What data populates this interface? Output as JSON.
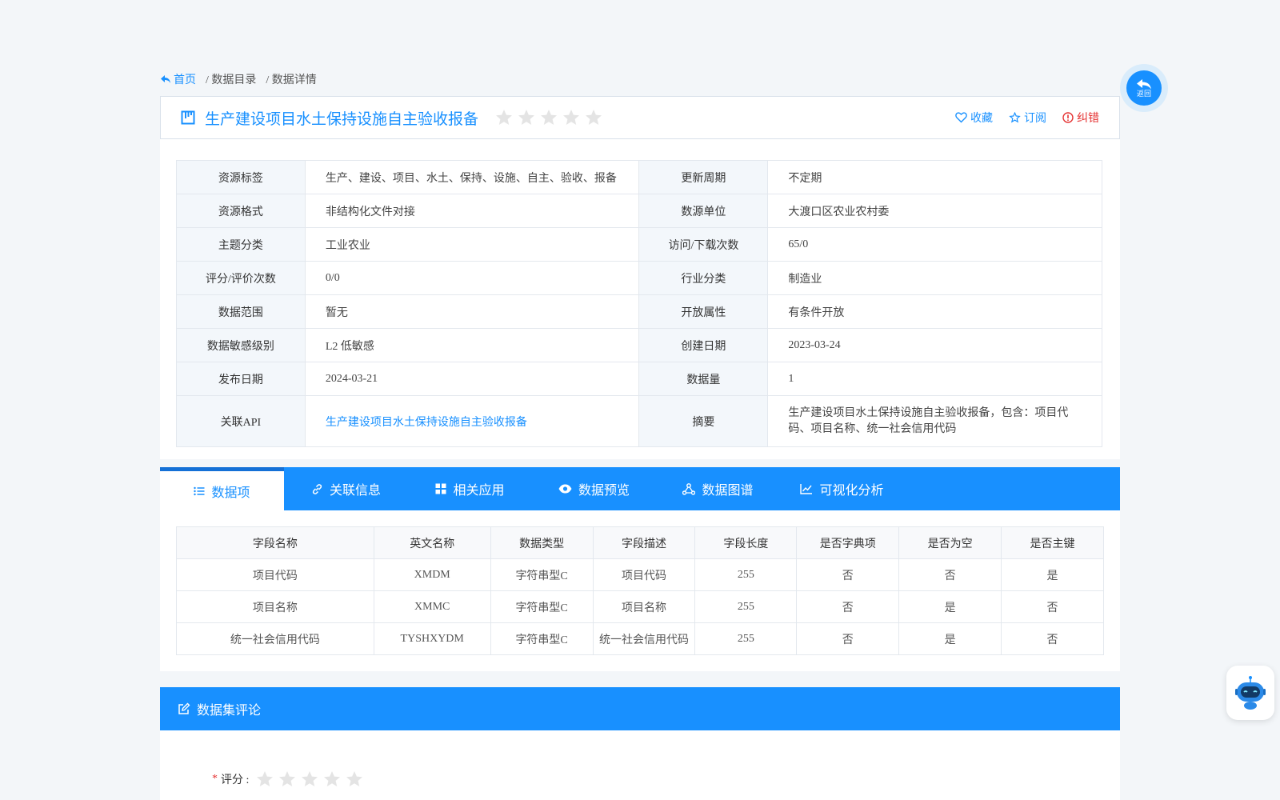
{
  "breadcrumb": {
    "home": "首页",
    "catalog": "/ 数据目录",
    "detail": "/ 数据详情"
  },
  "title": "生产建设项目水土保持设施自主验收报备",
  "rating": {
    "stars_total": 5,
    "stars_filled": 0
  },
  "actions": {
    "favorite": "收藏",
    "subscribe": "订阅",
    "report_error": "纠错"
  },
  "info": [
    {
      "k1": "资源标签",
      "v1": "生产、建设、项目、水土、保持、设施、自主、验收、报备",
      "k2": "更新周期",
      "v2": "不定期"
    },
    {
      "k1": "资源格式",
      "v1": "非结构化文件对接",
      "k2": "数源单位",
      "v2": "大渡口区农业农村委"
    },
    {
      "k1": "主题分类",
      "v1": "工业农业",
      "k2": "访问/下载次数",
      "v2": "65/0"
    },
    {
      "k1": "评分/评价次数",
      "v1": "0/0",
      "k2": "行业分类",
      "v2": "制造业"
    },
    {
      "k1": "数据范围",
      "v1": "暂无",
      "k2": "开放属性",
      "v2": "有条件开放"
    },
    {
      "k1": "数据敏感级别",
      "v1": "L2 低敏感",
      "k2": "创建日期",
      "v2": "2023-03-24"
    },
    {
      "k1": "发布日期",
      "v1": "2024-03-21",
      "k2": "数据量",
      "v2": "1"
    },
    {
      "k1": "关联API",
      "v1": "生产建设项目水土保持设施自主验收报备",
      "k2": "摘要",
      "v2": "生产建设项目水土保持设施自主验收报备，包含：项目代码、项目名称、统一社会信用代码"
    }
  ],
  "tabs": [
    "数据项",
    "关联信息",
    "相关应用",
    "数据预览",
    "数据图谱",
    "可视化分析"
  ],
  "fields": {
    "headers": [
      "字段名称",
      "英文名称",
      "数据类型",
      "字段描述",
      "字段长度",
      "是否字典项",
      "是否为空",
      "是否主键"
    ],
    "rows": [
      [
        "项目代码",
        "XMDM",
        "字符串型C",
        "项目代码",
        "255",
        "否",
        "否",
        "是"
      ],
      [
        "项目名称",
        "XMMC",
        "字符串型C",
        "项目名称",
        "255",
        "否",
        "是",
        "否"
      ],
      [
        "统一社会信用代码",
        "TYSHXYDM",
        "字符串型C",
        "统一社会信用代码",
        "255",
        "否",
        "是",
        "否"
      ]
    ]
  },
  "comments": {
    "title": "数据集评论",
    "rating_required": "*",
    "rating_label": "评分 :"
  },
  "back": {
    "label": "返回"
  },
  "colors": {
    "primary": "#1890ff",
    "error": "#e53333",
    "star_empty": "#e4e4e4"
  }
}
